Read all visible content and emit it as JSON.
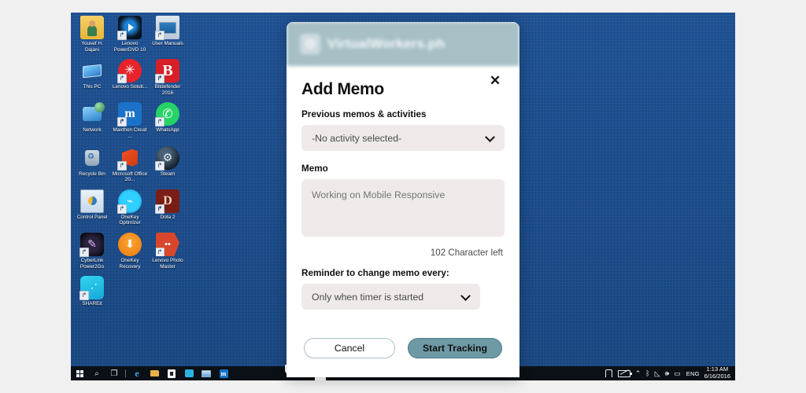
{
  "desktop": {
    "icons": [
      {
        "label": "Yousef H. Dajani",
        "art": "a-folder",
        "shortcut": false,
        "glyph": ""
      },
      {
        "label": "Lenovo PowerDVD 10",
        "art": "a-pdvd",
        "shortcut": true,
        "glyph": ""
      },
      {
        "label": "User Manuals",
        "art": "a-manual",
        "shortcut": true,
        "glyph": ""
      },
      {
        "label": "This PC",
        "art": "a-pc",
        "shortcut": false,
        "glyph": ""
      },
      {
        "label": "Lenovo Soluti...",
        "art": "a-lenovo",
        "shortcut": true,
        "glyph": "✳"
      },
      {
        "label": "Bitdefender 2016",
        "art": "a-bd",
        "shortcut": true,
        "glyph": "B"
      },
      {
        "label": "Network",
        "art": "a-net",
        "shortcut": false,
        "glyph": ""
      },
      {
        "label": "Maxthon Cloud ...",
        "art": "a-maxthon",
        "shortcut": true,
        "glyph": "m"
      },
      {
        "label": "WhatsApp",
        "art": "a-whatsapp",
        "shortcut": true,
        "glyph": "✆"
      },
      {
        "label": "Recycle Bin",
        "art": "a-recycle",
        "shortcut": false,
        "glyph": ""
      },
      {
        "label": "Microsoft Office 20...",
        "art": "a-office",
        "shortcut": true,
        "glyph": ""
      },
      {
        "label": "Steam",
        "art": "a-steam",
        "shortcut": true,
        "glyph": "⚙"
      },
      {
        "label": "Control Panel",
        "art": "a-control",
        "shortcut": false,
        "glyph": ""
      },
      {
        "label": "OneKey Optimizer",
        "art": "a-onekey",
        "shortcut": true,
        "glyph": "⌁"
      },
      {
        "label": "Dota 2",
        "art": "a-dota",
        "shortcut": true,
        "glyph": "D"
      },
      {
        "label": "CyberLink Power2Go",
        "art": "a-cyberlink",
        "shortcut": true,
        "glyph": "✎"
      },
      {
        "label": "OneKey Recovery",
        "art": "a-recovery",
        "shortcut": false,
        "glyph": "⬇"
      },
      {
        "label": "Lenovo Photo Master",
        "art": "a-photom",
        "shortcut": true,
        "glyph": "••"
      },
      {
        "label": "SHAREit",
        "art": "a-shareit",
        "shortcut": true,
        "glyph": "⋰"
      }
    ],
    "wallpaper_color": "#1d4f91"
  },
  "taskbar": {
    "start_label": "Start",
    "search_glyph": "⌕",
    "taskview_glyph": "❐",
    "pinned": [
      {
        "name": "edge",
        "glyph": "e"
      },
      {
        "name": "file-explorer",
        "glyph": ""
      },
      {
        "name": "store",
        "glyph": ""
      },
      {
        "name": "app-teal",
        "glyph": ""
      },
      {
        "name": "app-monitor",
        "glyph": ""
      },
      {
        "name": "maxthon",
        "glyph": "m"
      }
    ],
    "tray": {
      "chevron_glyph": "⌃",
      "bluetooth_glyph": "ᛒ",
      "network_glyph": "◺",
      "volume_glyph": "🕪",
      "action_center_glyph": "▭",
      "language": "ENG",
      "time": "1:13 AM",
      "date": "6/16/2016"
    }
  },
  "modal": {
    "brand": "VirtualWorkers.ph",
    "brand_logo_glyph": "❂",
    "close_glyph": "✕",
    "title": "Add Memo",
    "activity": {
      "label": "Previous memos & activities",
      "selected": "-No activity selected-",
      "options": [
        "-No activity selected-"
      ]
    },
    "memo": {
      "label": "Memo",
      "value": "Working on Mobile Responsive",
      "placeholder": "Working on Mobile Responsive",
      "characters_left": "102 Character left"
    },
    "reminder": {
      "label": "Reminder to change memo every:",
      "selected": "Only when timer is started",
      "options": [
        "Only when timer is started"
      ]
    },
    "buttons": {
      "cancel": "Cancel",
      "start": "Start Tracking"
    },
    "colors": {
      "header_teal": "#a6c0c6",
      "primary_button": "#6e9aa5",
      "field_background": "#efe9e9"
    }
  }
}
